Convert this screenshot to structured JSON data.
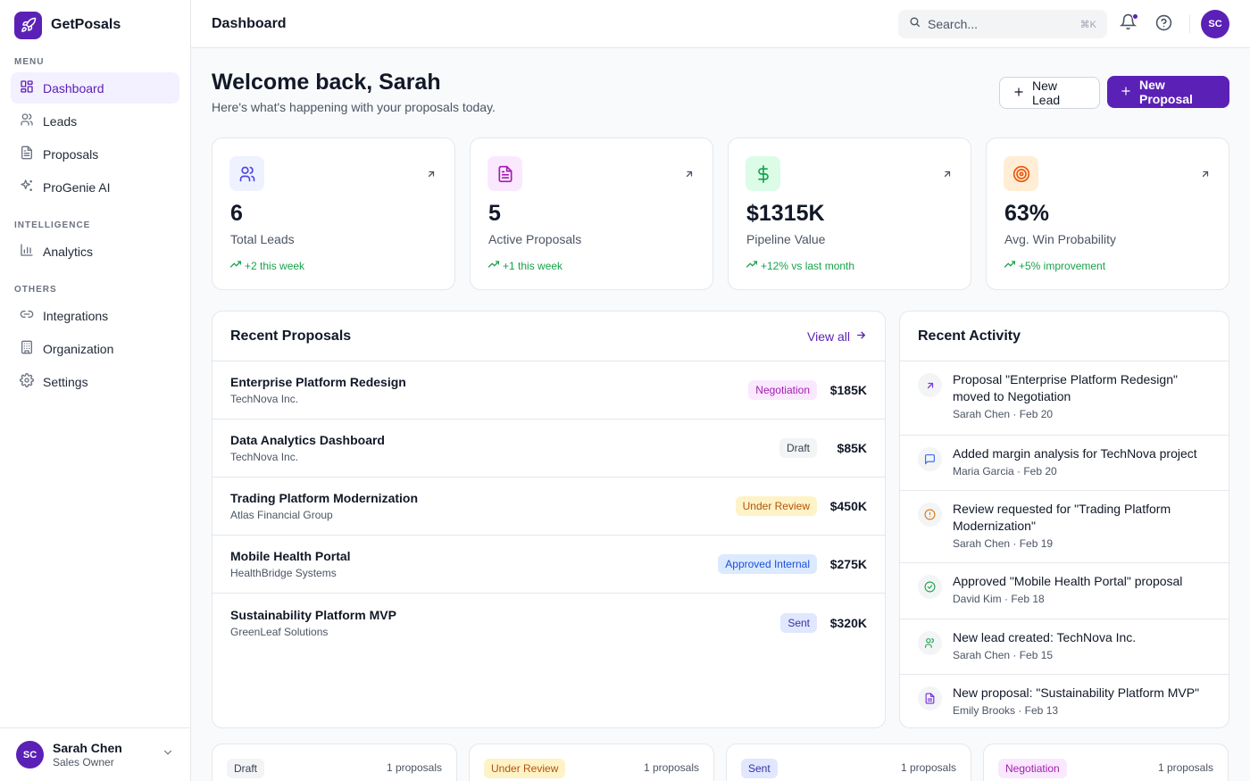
{
  "brand": {
    "name": "GetPosals"
  },
  "sidebar": {
    "sections": [
      {
        "label": "MENU",
        "items": [
          {
            "label": "Dashboard",
            "icon": "dashboard-icon",
            "active": true
          },
          {
            "label": "Leads",
            "icon": "users-icon"
          },
          {
            "label": "Proposals",
            "icon": "document-icon"
          },
          {
            "label": "ProGenie AI",
            "icon": "sparkles-icon"
          }
        ]
      },
      {
        "label": "INTELLIGENCE",
        "items": [
          {
            "label": "Analytics",
            "icon": "bar-chart-icon"
          }
        ]
      },
      {
        "label": "OTHERS",
        "items": [
          {
            "label": "Integrations",
            "icon": "link-icon"
          },
          {
            "label": "Organization",
            "icon": "building-icon"
          },
          {
            "label": "Settings",
            "icon": "gear-icon"
          }
        ]
      }
    ],
    "user": {
      "initials": "SC",
      "name": "Sarah Chen",
      "role": "Sales Owner"
    }
  },
  "topbar": {
    "title": "Dashboard",
    "search_placeholder": "Search...",
    "search_shortcut": "⌘K",
    "avatar_initials": "SC"
  },
  "welcome": {
    "title": "Welcome back, Sarah",
    "subtitle": "Here's what's happening with your proposals today.",
    "new_lead_label": "New Lead",
    "new_proposal_label": "New Proposal"
  },
  "stats": [
    {
      "value": "6",
      "label": "Total Leads",
      "trend": "+2 this week",
      "icon": "users-icon",
      "icon_bg": "#eef2ff",
      "icon_color": "#4f46e5"
    },
    {
      "value": "5",
      "label": "Active Proposals",
      "trend": "+1 this week",
      "icon": "document-icon",
      "icon_bg": "#fae8ff",
      "icon_color": "#a21caf"
    },
    {
      "value": "$1315K",
      "label": "Pipeline Value",
      "trend": "+12% vs last month",
      "icon": "dollar-icon",
      "icon_bg": "#dcfce7",
      "icon_color": "#16a34a"
    },
    {
      "value": "63%",
      "label": "Avg. Win Probability",
      "trend": "+5% improvement",
      "icon": "target-icon",
      "icon_bg": "#ffedd5",
      "icon_color": "#ea580c"
    }
  ],
  "recent_proposals": {
    "title": "Recent Proposals",
    "view_all": "View all",
    "rows": [
      {
        "name": "Enterprise Platform Redesign",
        "client": "TechNova Inc.",
        "status": "Negotiation",
        "amount": "$185K",
        "badge_bg": "#fae8ff",
        "badge_color": "#a21caf"
      },
      {
        "name": "Data Analytics Dashboard",
        "client": "TechNova Inc.",
        "status": "Draft",
        "amount": "$85K",
        "badge_bg": "#f3f4f6",
        "badge_color": "#374151"
      },
      {
        "name": "Trading Platform Modernization",
        "client": "Atlas Financial Group",
        "status": "Under Review",
        "amount": "$450K",
        "badge_bg": "#fef3c7",
        "badge_color": "#b45309"
      },
      {
        "name": "Mobile Health Portal",
        "client": "HealthBridge Systems",
        "status": "Approved Internal",
        "amount": "$275K",
        "badge_bg": "#dbeafe",
        "badge_color": "#1d4ed8"
      },
      {
        "name": "Sustainability Platform MVP",
        "client": "GreenLeaf Solutions",
        "status": "Sent",
        "amount": "$320K",
        "badge_bg": "#e0e7ff",
        "badge_color": "#3730a3"
      }
    ]
  },
  "recent_activity": {
    "title": "Recent Activity",
    "items": [
      {
        "text": "Proposal \"Enterprise Platform Redesign\" moved to Negotiation",
        "meta": "Sarah Chen · Feb 20",
        "icon": "arrow-up-right-icon",
        "icon_color": "#7c3aed"
      },
      {
        "text": "Added margin analysis for TechNova project",
        "meta": "Maria Garcia · Feb 20",
        "icon": "message-icon",
        "icon_color": "#2563eb"
      },
      {
        "text": "Review requested for \"Trading Platform Modernization\"",
        "meta": "Sarah Chen · Feb 19",
        "icon": "alert-circle-icon",
        "icon_color": "#d97706"
      },
      {
        "text": "Approved \"Mobile Health Portal\" proposal",
        "meta": "David Kim · Feb 18",
        "icon": "check-circle-icon",
        "icon_color": "#16a34a"
      },
      {
        "text": "New lead created: TechNova Inc.",
        "meta": "Sarah Chen · Feb 15",
        "icon": "users-icon",
        "icon_color": "#16a34a"
      },
      {
        "text": "New proposal: \"Sustainability Platform MVP\"",
        "meta": "Emily Brooks · Feb 13",
        "icon": "document-icon",
        "icon_color": "#6d28d9"
      }
    ]
  },
  "status_summary": [
    {
      "status": "Draft",
      "count": "1 proposals",
      "badge_bg": "#f3f4f6",
      "badge_color": "#374151"
    },
    {
      "status": "Under Review",
      "count": "1 proposals",
      "badge_bg": "#fef3c7",
      "badge_color": "#b45309"
    },
    {
      "status": "Sent",
      "count": "1 proposals",
      "badge_bg": "#e0e7ff",
      "badge_color": "#3730a3"
    },
    {
      "status": "Negotiation",
      "count": "1 proposals",
      "badge_bg": "#fae8ff",
      "badge_color": "#a21caf"
    }
  ]
}
